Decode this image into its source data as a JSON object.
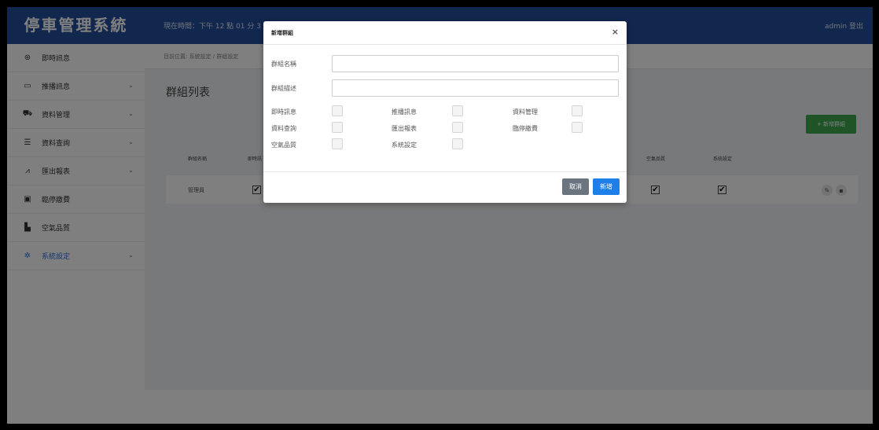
{
  "app": {
    "brand": "停車管理系統"
  },
  "topbar": {
    "time": "現在時間：下午 12 點 01 分 3",
    "user": "admin 登出"
  },
  "sidebar": {
    "items": [
      {
        "label": "即時訊息",
        "icon": "dashboard-icon",
        "glyph": "⊛",
        "expandable": false
      },
      {
        "label": "推播訊息",
        "icon": "monitor-icon",
        "glyph": "▭",
        "expandable": true
      },
      {
        "label": "資料管理",
        "icon": "car-icon",
        "glyph": "⛟",
        "expandable": true
      },
      {
        "label": "資料查詢",
        "icon": "database-icon",
        "glyph": "☰",
        "expandable": true
      },
      {
        "label": "匯出報表",
        "icon": "area-chart-icon",
        "glyph": "⩘",
        "expandable": true
      },
      {
        "label": "臨停繳費",
        "icon": "money-icon",
        "glyph": "▣",
        "expandable": false
      },
      {
        "label": "空氣品質",
        "icon": "industry-icon",
        "glyph": "▙",
        "expandable": false
      },
      {
        "label": "系統設定",
        "icon": "gears-icon",
        "glyph": "✲",
        "expandable": true,
        "active": true
      }
    ],
    "chevron": "⌄"
  },
  "breadcrumb": "目前位置: 系統設定 / 群組設定",
  "page": {
    "title": "群組列表",
    "add_button": "+ 新增群組"
  },
  "table": {
    "headers": [
      "群組名稱",
      "即時訊",
      "空氣品質",
      "系統設定"
    ],
    "row": {
      "name": "管理員",
      "check": "✔"
    },
    "edit_glyph": "✎",
    "delete_glyph": "▪"
  },
  "modal": {
    "title": "新增群組",
    "close": "×",
    "name_label": "群組名稱",
    "desc_label": "群組描述",
    "name_value": "",
    "desc_value": "",
    "permissions": [
      "即時訊息",
      "推播訊息",
      "資料管理",
      "資料查詢",
      "匯出報表",
      "臨停繳費",
      "空氣品質",
      "系統設定"
    ],
    "cancel": "取消",
    "submit": "新增"
  },
  "colors": {
    "header_blue": "#254f9c",
    "primary": "#1e7fe8",
    "success": "#3fa94f",
    "secondary": "#6b7580",
    "active_menu": "#2a6fdb"
  }
}
